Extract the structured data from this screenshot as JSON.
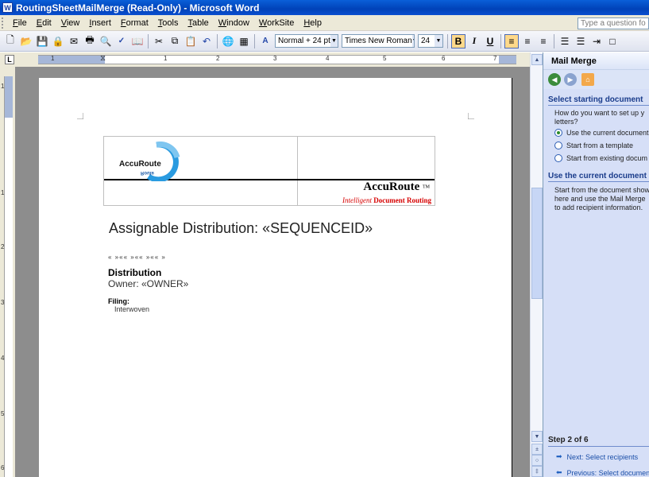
{
  "window": {
    "title": "RoutingSheetMailMerge (Read-Only) - Microsoft Word",
    "app_icon": "W"
  },
  "menu": {
    "items": [
      "File",
      "Edit",
      "View",
      "Insert",
      "Format",
      "Tools",
      "Table",
      "Window",
      "WorkSite",
      "Help"
    ],
    "ask_placeholder": "Type a question fo"
  },
  "toolbar": {
    "style": "Normal + 24 pt",
    "font": "Times New Roman",
    "size": "24",
    "bold": "B",
    "italic": "I",
    "underline": "U"
  },
  "ruler": {
    "numbers": [
      "1",
      "1",
      "2",
      "3",
      "4",
      "5",
      "6",
      "7"
    ],
    "v_numbers": [
      "1",
      "1",
      "2",
      "3",
      "4",
      "5",
      "6"
    ]
  },
  "document": {
    "brand_name": "AccuRoute",
    "brand_tm": "TM",
    "brand_tag_italic": "Intelligent",
    "brand_tag_bold": "Document Routing",
    "title": "Assignable Distribution: «SEQUENCEID»",
    "fields": "« »«« »«« »«« »",
    "distribution_heading": "Distribution",
    "owner_line": "Owner: «OWNER»",
    "filing_heading": "Filing:",
    "filing_value": "Interwoven"
  },
  "taskpane": {
    "title": "Mail Merge",
    "section1": "Select starting document",
    "question": [
      "How do you want to set up y",
      "letters?"
    ],
    "options": [
      "Use the current document",
      "Start from a template",
      "Start from existing docum"
    ],
    "selected_option": 0,
    "section2": "Use the current document",
    "description": [
      "Start from the document show",
      "here and use the Mail Merge",
      "to add recipient information."
    ],
    "step": "Step 2 of 6",
    "next_link": "Next: Select recipients",
    "prev_link": "Previous: Select documen"
  },
  "colors": {
    "titlebar": "#0a5fd8",
    "taskpane_bg": "#d6dff7",
    "brand_red": "#d60000",
    "link": "#1b4fa8"
  }
}
